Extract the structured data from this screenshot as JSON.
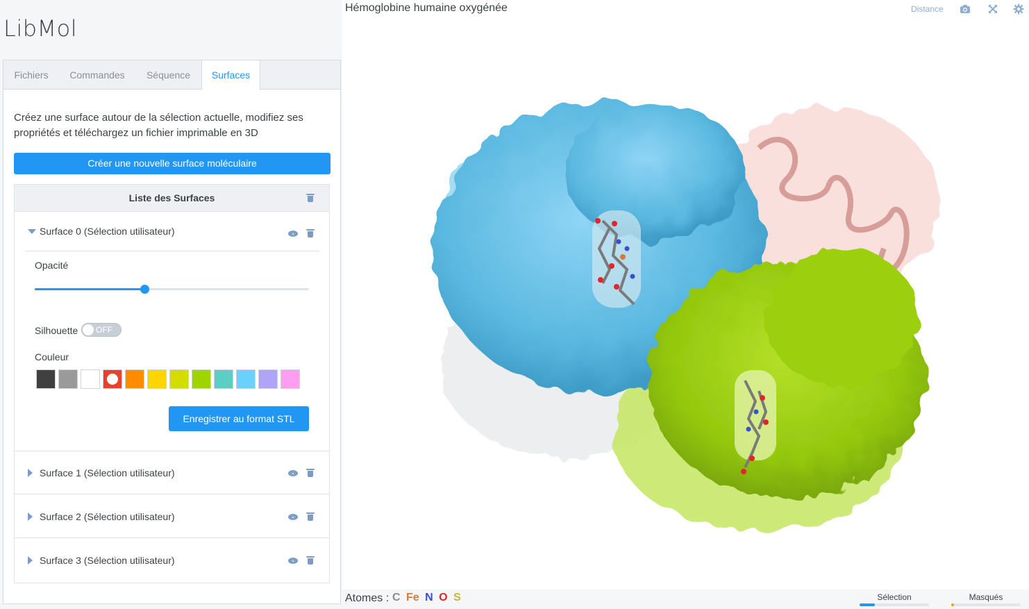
{
  "app": {
    "logo": "LibMol"
  },
  "tabs": [
    {
      "label": "Fichiers"
    },
    {
      "label": "Commandes"
    },
    {
      "label": "Séquence"
    },
    {
      "label": "Surfaces",
      "active": true
    }
  ],
  "surfaces_panel": {
    "intro": "Créez une surface autour de la sélection actuelle, modifiez ses propriétés et téléchargez un fichier imprimable en 3D",
    "create_button": "Créer une nouvelle surface moléculaire",
    "list_title": "Liste des Surfaces",
    "items": [
      {
        "label": "Surface 0 (Sélection utilisateur)",
        "expanded": true
      },
      {
        "label": "Surface 1 (Sélection utilisateur)",
        "expanded": false
      },
      {
        "label": "Surface 2 (Sélection utilisateur)",
        "expanded": false
      },
      {
        "label": "Surface 3 (Sélection utilisateur)",
        "expanded": false
      }
    ],
    "opacity_label": "Opacité",
    "opacity_value": 0.4,
    "silhouette_label": "Silhouette",
    "silhouette_state": "OFF",
    "color_label": "Couleur",
    "colors": [
      "#404040",
      "#9a9a9a",
      "#ffffff",
      "#e8412e",
      "#ff8c00",
      "#ffd500",
      "#d4dc00",
      "#a0d400",
      "#5ccfc4",
      "#69d2fb",
      "#b0a4f7",
      "#ff9ef0"
    ],
    "selected_color_index": 3,
    "stl_button": "Enregistrer au format STL"
  },
  "viewer": {
    "title": "Hémoglobine humaine oxygénée",
    "distance_label": "Distance",
    "icons": [
      "camera-icon",
      "fullscreen-icon",
      "gear-icon"
    ],
    "atoms_label": "Atomes :",
    "atoms": [
      {
        "symbol": "C",
        "color": "#8d8d8d"
      },
      {
        "symbol": "Fe",
        "color": "#d57a3d"
      },
      {
        "symbol": "N",
        "color": "#3a4fd0"
      },
      {
        "symbol": "O",
        "color": "#e5242a"
      },
      {
        "symbol": "S",
        "color": "#c7b43a"
      }
    ],
    "selection_label": "Sélection",
    "selection_fraction": 0.22,
    "masked_label": "Masqués",
    "masked_fraction": 0.04
  }
}
